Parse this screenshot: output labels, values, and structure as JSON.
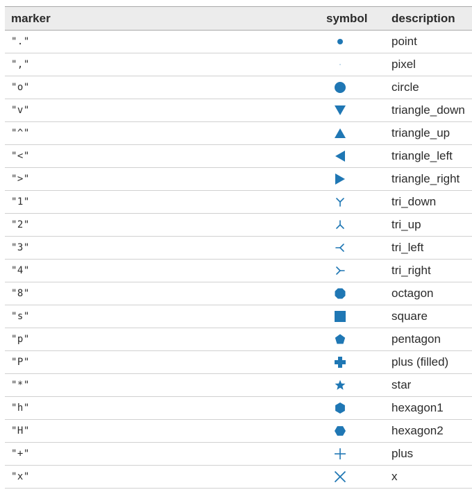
{
  "table": {
    "headers": {
      "marker": "marker",
      "symbol": "symbol",
      "description": "description"
    },
    "accent_color": "#1f77b4",
    "rows": [
      {
        "marker": "\".\"",
        "symbol_icon": "point-marker-icon",
        "description": "point"
      },
      {
        "marker": "\",\"",
        "symbol_icon": "pixel-marker-icon",
        "description": "pixel"
      },
      {
        "marker": "\"o\"",
        "symbol_icon": "circle-marker-icon",
        "description": "circle"
      },
      {
        "marker": "\"v\"",
        "symbol_icon": "triangle-down-marker-icon",
        "description": "triangle_down"
      },
      {
        "marker": "\"^\"",
        "symbol_icon": "triangle-up-marker-icon",
        "description": "triangle_up"
      },
      {
        "marker": "\"<\"",
        "symbol_icon": "triangle-left-marker-icon",
        "description": "triangle_left"
      },
      {
        "marker": "\">\"",
        "symbol_icon": "triangle-right-marker-icon",
        "description": "triangle_right"
      },
      {
        "marker": "\"1\"",
        "symbol_icon": "tri-down-marker-icon",
        "description": "tri_down"
      },
      {
        "marker": "\"2\"",
        "symbol_icon": "tri-up-marker-icon",
        "description": "tri_up"
      },
      {
        "marker": "\"3\"",
        "symbol_icon": "tri-left-marker-icon",
        "description": "tri_left"
      },
      {
        "marker": "\"4\"",
        "symbol_icon": "tri-right-marker-icon",
        "description": "tri_right"
      },
      {
        "marker": "\"8\"",
        "symbol_icon": "octagon-marker-icon",
        "description": "octagon"
      },
      {
        "marker": "\"s\"",
        "symbol_icon": "square-marker-icon",
        "description": "square"
      },
      {
        "marker": "\"p\"",
        "symbol_icon": "pentagon-marker-icon",
        "description": "pentagon"
      },
      {
        "marker": "\"P\"",
        "symbol_icon": "plus-filled-marker-icon",
        "description": "plus (filled)"
      },
      {
        "marker": "\"*\"",
        "symbol_icon": "star-marker-icon",
        "description": "star"
      },
      {
        "marker": "\"h\"",
        "symbol_icon": "hexagon1-marker-icon",
        "description": "hexagon1"
      },
      {
        "marker": "\"H\"",
        "symbol_icon": "hexagon2-marker-icon",
        "description": "hexagon2"
      },
      {
        "marker": "\"+\"",
        "symbol_icon": "plus-marker-icon",
        "description": "plus"
      },
      {
        "marker": "\"x\"",
        "symbol_icon": "x-marker-icon",
        "description": "x"
      }
    ]
  }
}
